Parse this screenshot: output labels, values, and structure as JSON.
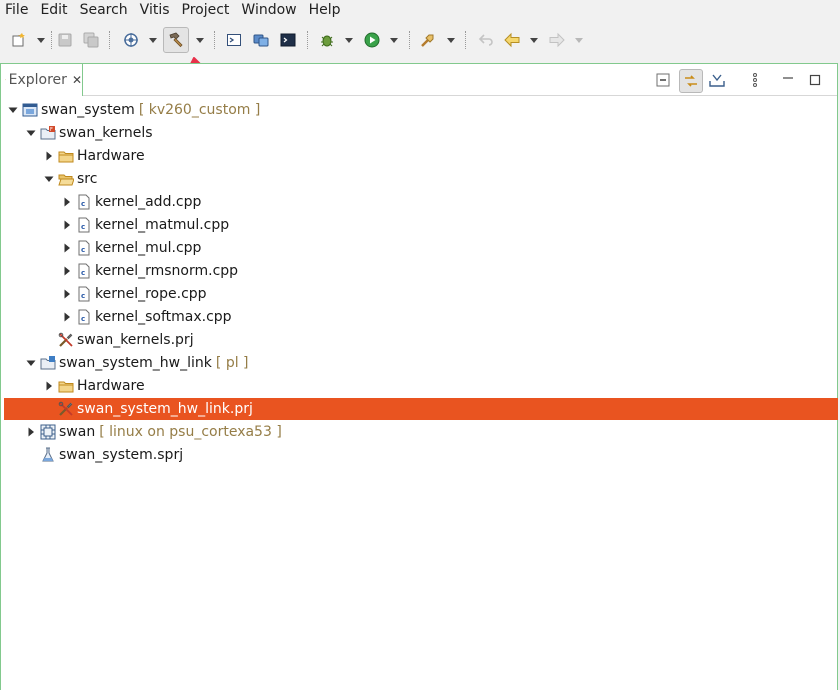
{
  "menubar": {
    "items": [
      "File",
      "Edit",
      "Search",
      "Vitis",
      "Project",
      "Window",
      "Help"
    ]
  },
  "toolbar": {
    "buttons": [
      {
        "name": "new-icon",
        "dropdown": true
      },
      {
        "name": "save-icon",
        "dropdown": false
      },
      {
        "name": "save-all-icon",
        "dropdown": false
      },
      {
        "name": "target-icon",
        "dropdown": true
      },
      {
        "name": "build-hammer-icon",
        "dropdown": true,
        "active": true
      },
      {
        "name": "terminal-icon",
        "dropdown": false
      },
      {
        "name": "remote-connect-icon",
        "dropdown": false
      },
      {
        "name": "console-icon",
        "dropdown": false
      },
      {
        "name": "debug-bug-icon",
        "dropdown": true
      },
      {
        "name": "run-icon",
        "dropdown": true
      },
      {
        "name": "external-tools-icon",
        "dropdown": true
      },
      {
        "name": "last-edit-icon",
        "dropdown": false
      },
      {
        "name": "back-arrow-icon",
        "dropdown": true
      },
      {
        "name": "forward-arrow-icon",
        "dropdown": true
      }
    ]
  },
  "annotation": {
    "arrow_color": "#e8304a"
  },
  "explorer": {
    "tab_label": "Explorer",
    "close_glyph": "✕",
    "accent": "#82c98d",
    "selection_color": "#e95420"
  },
  "tree": [
    {
      "label": "swan_system",
      "decoration": "[ kv260_custom ]",
      "icon": "system-project-icon",
      "twisty": "expanded",
      "depth": 0
    },
    {
      "label": "swan_kernels",
      "decoration": "",
      "icon": "hw-kernel-project-icon",
      "twisty": "expanded",
      "depth": 1
    },
    {
      "label": "Hardware",
      "decoration": "",
      "icon": "folder-icon",
      "twisty": "collapsed",
      "depth": 2
    },
    {
      "label": "src",
      "decoration": "",
      "icon": "folder-open-icon",
      "twisty": "expanded",
      "depth": 2
    },
    {
      "label": "kernel_add.cpp",
      "decoration": "",
      "icon": "cpp-file-icon",
      "twisty": "collapsed",
      "depth": 3
    },
    {
      "label": "kernel_matmul.cpp",
      "decoration": "",
      "icon": "cpp-file-icon",
      "twisty": "collapsed",
      "depth": 3
    },
    {
      "label": "kernel_mul.cpp",
      "decoration": "",
      "icon": "cpp-file-icon",
      "twisty": "collapsed",
      "depth": 3
    },
    {
      "label": "kernel_rmsnorm.cpp",
      "decoration": "",
      "icon": "cpp-file-icon",
      "twisty": "collapsed",
      "depth": 3
    },
    {
      "label": "kernel_rope.cpp",
      "decoration": "",
      "icon": "cpp-file-icon",
      "twisty": "collapsed",
      "depth": 3
    },
    {
      "label": "kernel_softmax.cpp",
      "decoration": "",
      "icon": "cpp-file-icon",
      "twisty": "collapsed",
      "depth": 3
    },
    {
      "label": "swan_kernels.prj",
      "decoration": "",
      "icon": "prj-settings-icon",
      "twisty": "none",
      "depth": 2
    },
    {
      "label": "swan_system_hw_link",
      "decoration": "[ pl ]",
      "icon": "hw-link-project-icon",
      "twisty": "expanded",
      "depth": 1
    },
    {
      "label": "Hardware",
      "decoration": "",
      "icon": "folder-icon",
      "twisty": "collapsed",
      "depth": 2
    },
    {
      "label": "swan_system_hw_link.prj",
      "decoration": "",
      "icon": "prj-settings-icon",
      "twisty": "none",
      "depth": 2,
      "selected": true
    },
    {
      "label": "swan",
      "decoration": "[ linux on psu_cortexa53 ]",
      "icon": "app-project-icon",
      "twisty": "collapsed",
      "depth": 1
    },
    {
      "label": "swan_system.sprj",
      "decoration": "",
      "icon": "sprj-flask-icon",
      "twisty": "none",
      "depth": 1
    }
  ]
}
